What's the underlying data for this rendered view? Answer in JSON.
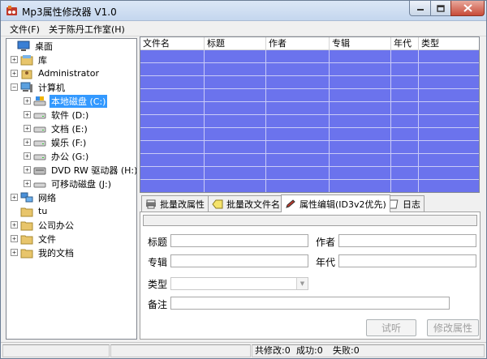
{
  "window": {
    "title": "Mp3属性修改器 V1.0"
  },
  "menu": {
    "file": "文件(F)",
    "about": "关于陈丹工作室(H)"
  },
  "tree": {
    "desktop": "桌面",
    "library": "库",
    "admin": "Administrator",
    "computer": "计算机",
    "drive_c": "本地磁盘 (C:)",
    "drive_d": "软件 (D:)",
    "drive_e": "文档 (E:)",
    "drive_f": "娱乐 (F:)",
    "drive_g": "办公 (G:)",
    "drive_h": "DVD RW 驱动器 (H:)",
    "drive_j": "可移动磁盘 (J:)",
    "network": "网络",
    "tu": "tu",
    "office": "公司办公",
    "files": "文件",
    "mydocs": "我的文档"
  },
  "list": {
    "columns": [
      "文件名",
      "标题",
      "作者",
      "专辑",
      "年代",
      "类型"
    ]
  },
  "tabs": {
    "batch_attr": "批量改属性",
    "batch_name": "批量改文件名",
    "attr_edit": "属性编辑(ID3v2优先)",
    "log": "日志"
  },
  "form": {
    "title_label": "标题",
    "author_label": "作者",
    "album_label": "专辑",
    "year_label": "年代",
    "genre_label": "类型",
    "comment_label": "备注",
    "title_value": "",
    "author_value": "",
    "album_value": "",
    "year_value": "",
    "comment_value": "",
    "listen_button": "试听",
    "modify_button": "修改属性"
  },
  "status": {
    "total": "共修改:0",
    "success": "成功:0",
    "fail": "失败:0"
  }
}
